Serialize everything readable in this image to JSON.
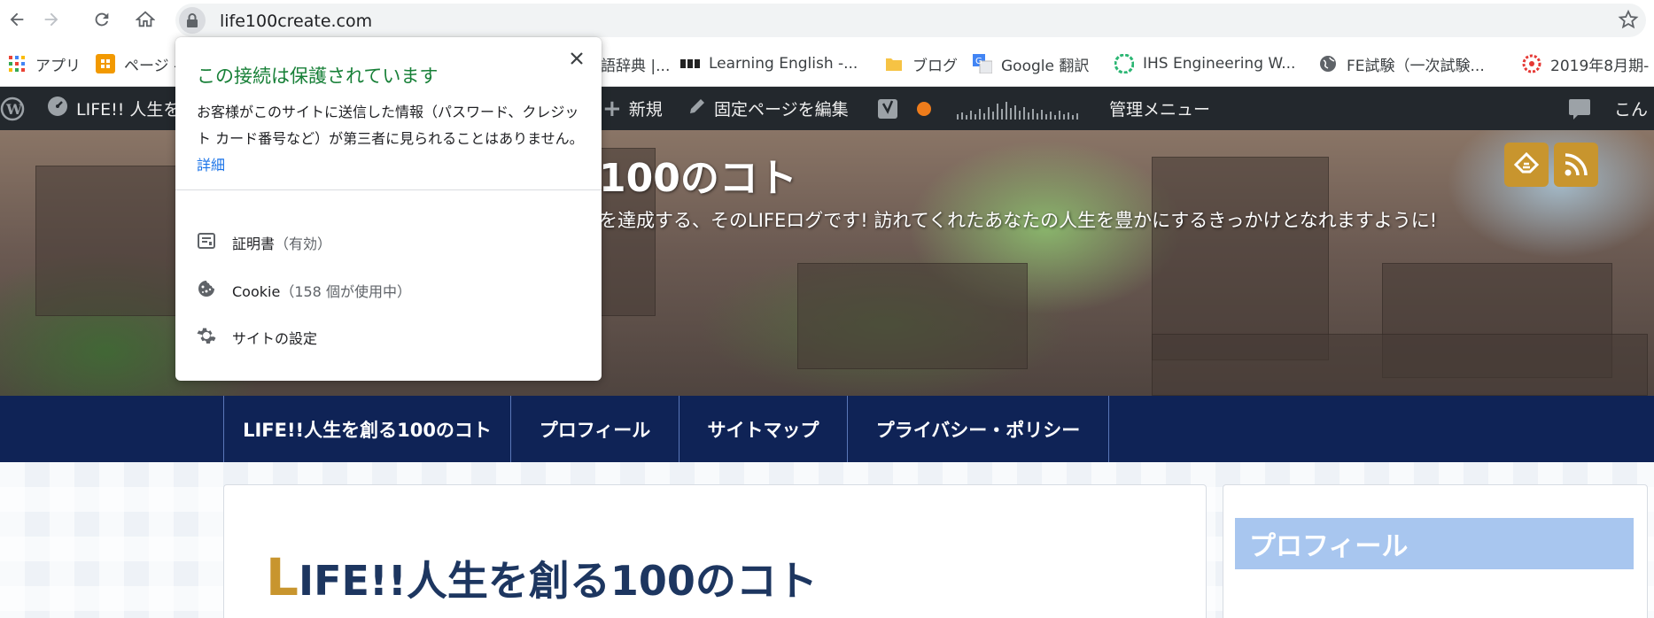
{
  "browser": {
    "url": "life100create.com",
    "icons": [
      "back-icon",
      "forward-icon",
      "reload-icon",
      "home-icon",
      "lock-icon",
      "star-icon"
    ]
  },
  "bookmarks": [
    {
      "label": "アプリ",
      "icon": "apps-grid-icon"
    },
    {
      "label": "ページ -",
      "icon": "orange-app-icon"
    },
    {
      "label": "語辞典 |...",
      "icon": ""
    },
    {
      "label": "Learning English -...",
      "icon": "bbc-icon"
    },
    {
      "label": "ブログ",
      "icon": "folder-icon"
    },
    {
      "label": "Google 翻訳",
      "icon": "google-translate-icon"
    },
    {
      "label": "IHS Engineering W...",
      "icon": "ihs-icon"
    },
    {
      "label": "FE試験（一次試験...",
      "icon": "globe-icon"
    },
    {
      "label": "2019年8月期-",
      "icon": "red-flower-icon"
    }
  ],
  "adminbar": {
    "site": "LIFE!! 人生を",
    "new": "新規",
    "edit": "固定ページを編集",
    "manage": "管理メニュー",
    "greeting": "こん"
  },
  "header": {
    "title": "100のコト",
    "description": "を達成する、そのLIFEログです! 訪れてくれたあなたの人生を豊かにするきっかけとなれますように!"
  },
  "nav": {
    "items": [
      "LIFE!!人生を創る100のコト",
      "プロフィール",
      "サイトマップ",
      "プライバシー・ポリシー"
    ]
  },
  "article": {
    "first_letter": "L",
    "title_rest": "IFE!!人生を創る100のコト"
  },
  "sidebar": {
    "heading": "プロフィール"
  },
  "popup": {
    "title": "この接続は保護されています",
    "description": "お客様がこのサイトに送信した情報（パスワード、クレジット カード番号など）が第三者に見られることはありません。",
    "details_link": "詳細",
    "certificate_label": "証明書",
    "certificate_status": "（有効）",
    "cookie_label": "Cookie",
    "cookie_status": "（158 個が使用中）",
    "settings_label": "サイトの設定"
  },
  "colors": {
    "secure_green": "#188038",
    "link_blue": "#1a73e8",
    "nav_bg": "#0f2356",
    "accent_gold": "#c8952e",
    "adminbar_bg": "#23282d"
  }
}
